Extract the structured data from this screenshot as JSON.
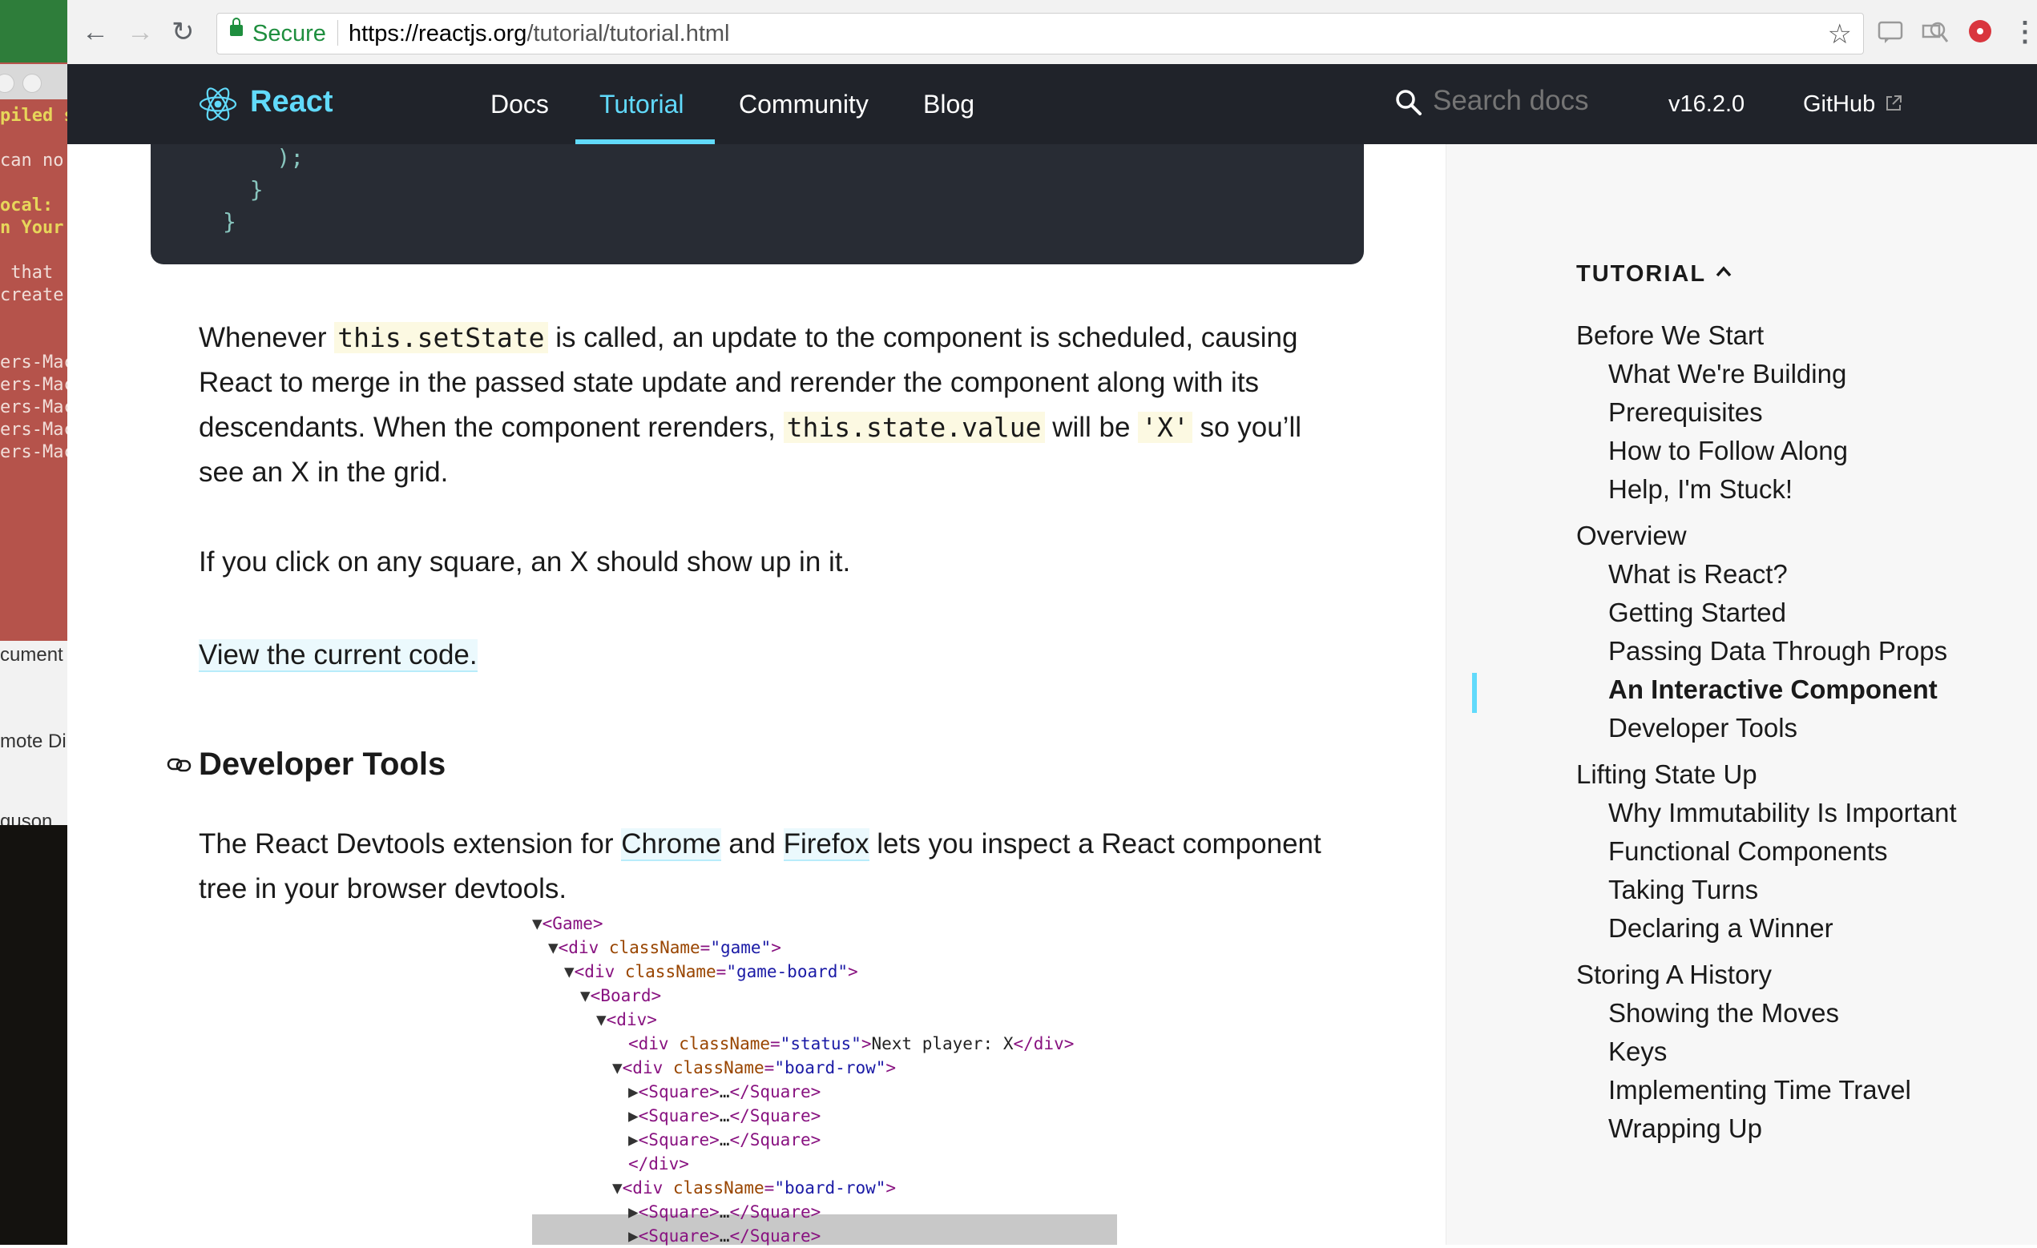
{
  "background_terminal": {
    "lines": [
      "piled s",
      "can no",
      "ocal:",
      "n Your",
      " that",
      "create",
      "ers-Mac",
      "ers-Mac",
      "ers-Mac",
      "ers-Mac",
      "ers-Mac"
    ],
    "side_texts": [
      "cument",
      "mote Di",
      "guson"
    ]
  },
  "browser": {
    "secure_label": "Secure",
    "url_host": "https://reactjs.org",
    "url_path": "/tutorial/tutorial.html"
  },
  "site": {
    "brand": "React",
    "nav": [
      "Docs",
      "Tutorial",
      "Community",
      "Blog"
    ],
    "search_placeholder": "Search docs",
    "version": "v16.2.0",
    "github": "GitHub"
  },
  "code_tail": [
    "    );",
    "  }",
    "}"
  ],
  "content": {
    "p1_a": "Whenever ",
    "p1_code1": "this.setState",
    "p1_b": " is called, an update to the component is scheduled, causing React to merge in the passed state update and rerender the component along with its descendants. When the component rerenders, ",
    "p1_code2": "this.state.value",
    "p1_c": " will be ",
    "p1_code3": "'X'",
    "p1_d": " so you’ll see an X in the grid.",
    "p2": "If you click on any square, an X should show up in it.",
    "view_code_link": "View the current code.",
    "dev_heading": "Developer Tools",
    "p3_a": "The React Devtools extension for ",
    "p3_chrome": "Chrome",
    "p3_b": " and ",
    "p3_firefox": "Firefox",
    "p3_c": " lets you inspect a React component tree in your browser devtools."
  },
  "devtree": {
    "game": "<Game>",
    "div_game": [
      "<div ",
      "className",
      "=",
      "\"game\"",
      ">"
    ],
    "div_board": [
      "<div ",
      "className",
      "=",
      "\"game-board\"",
      ">"
    ],
    "board": "<Board>",
    "div": "<div>",
    "status": [
      "<div ",
      "className",
      "=",
      "\"status\"",
      ">",
      "Next player: X",
      "</div>"
    ],
    "board_row": [
      "<div ",
      "className",
      "=",
      "\"board-row\"",
      ">"
    ],
    "square": [
      "<Square>",
      "…",
      "</Square>"
    ],
    "close_div": "</div>"
  },
  "sidebar": {
    "title": "TUTORIAL",
    "sections": [
      {
        "label": "Before We Start",
        "items": [
          "What We're Building",
          "Prerequisites",
          "How to Follow Along",
          "Help, I'm Stuck!"
        ]
      },
      {
        "label": "Overview",
        "items": [
          "What is React?",
          "Getting Started",
          "Passing Data Through Props",
          "An Interactive Component",
          "Developer Tools"
        ]
      },
      {
        "label": "Lifting State Up",
        "items": [
          "Why Immutability Is Important",
          "Functional Components",
          "Taking Turns",
          "Declaring a Winner"
        ]
      },
      {
        "label": "Storing A History",
        "items": [
          "Showing the Moves",
          "Keys",
          "Implementing Time Travel",
          "Wrapping Up"
        ]
      }
    ],
    "active_item": "An Interactive Component"
  },
  "colors": {
    "accent": "#61dafb",
    "header_bg": "#20232a",
    "secure_green": "#1e8e3e"
  }
}
